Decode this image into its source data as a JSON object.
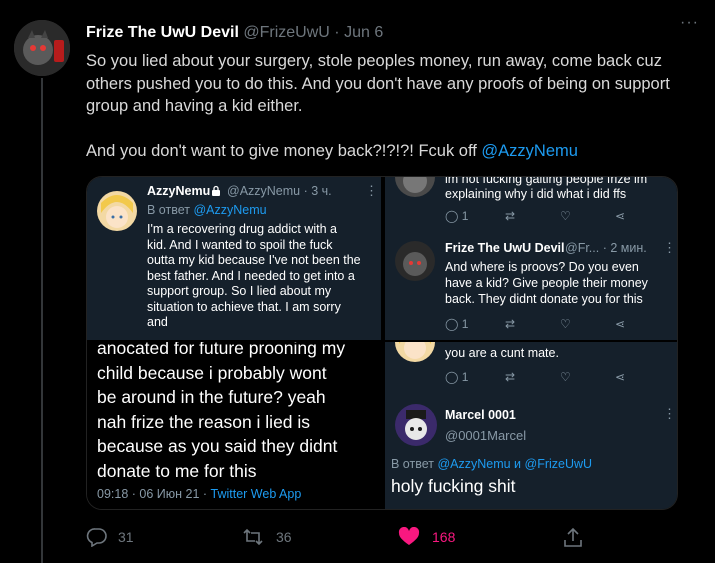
{
  "tweet": {
    "author_name": "Frize The UwU Devil",
    "handle": "@FrizeUwU",
    "separator": "·",
    "date": "Jun 6",
    "more": "···",
    "text_line1": "So you lied about your surgery, stole peoples money, run away, come back cuz others pushed you to do this. And you don't have any proofs of being on support group and having a kid either.",
    "text_line2": "And you don't want to give money back?!?!?!  Fcuk off ",
    "mention": "@AzzyNemu"
  },
  "embedded": {
    "top_left": {
      "name": "AzzyNemu",
      "lock_icon": "lock-icon",
      "handle": "@AzzyNemu · 3 ч.",
      "more": "⋮",
      "reply_prefix": "В ответ ",
      "reply_mention": "@AzzyNemu",
      "lines": [
        "I'm a recovering drug addict with a",
        "kid. And I wanted to spoil the fuck",
        "outta my kid because I've not been the",
        "best father. And I needed to get into a",
        "support group. So I lied about my",
        "situation to achieve that. I am sorry",
        "and"
      ]
    },
    "bottom_left": {
      "lines": [
        "anocated for future prooning my",
        "child because i probably wont",
        "be around in the future? yeah",
        "nah frize the reason i lied is",
        "because as you said they didnt",
        "donate to me for this"
      ],
      "meta_time": "09:18 · 06 Июн 21 · ",
      "meta_client": "Twitter Web App"
    },
    "top_right": {
      "cut_line1": "im not fucking gaiting people frize im",
      "cut_line2": "explaining why i did what i did ffs",
      "reply_count_1": "1",
      "name": "Frize The UwU Devil",
      "handle": "@Fr... · 2 мин.",
      "more": "⋮",
      "lines": [
        "And where is proovs? Do you even",
        "have a kid? Give people their money",
        "back. They didnt donate you for this"
      ],
      "reply_count_2": "1"
    },
    "bottom_right": {
      "cut_line": "you are a cunt mate.",
      "reply_count": "1",
      "name": "Marcel 0001",
      "handle": "@0001Marcel",
      "more": "⋮",
      "reply_prefix": "В ответ ",
      "reply_mentions": "@AzzyNemu и @FrizeUwU",
      "text": "holy fucking shit"
    }
  },
  "actions": {
    "reply_count": "31",
    "retweet_count": "36",
    "like_count": "168",
    "like_color": "#f91880"
  },
  "colors": {
    "background": "#000000",
    "text": "#d9d9d9",
    "muted": "#6e767d",
    "accent": "#1d9bf0",
    "dim_bg": "#15202b"
  }
}
